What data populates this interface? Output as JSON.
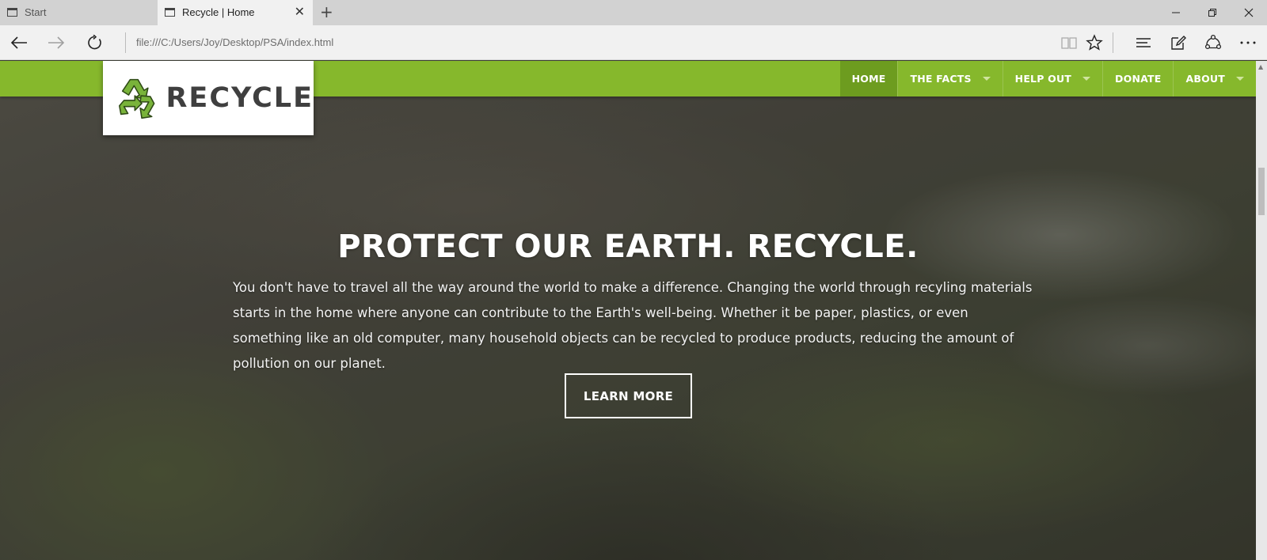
{
  "browser": {
    "tabs": [
      {
        "label": "Start",
        "active": false
      },
      {
        "label": "Recycle | Home",
        "active": true
      }
    ],
    "url": "file:///C:/Users/Joy/Desktop/PSA/index.html"
  },
  "site": {
    "logo_text": "RECYCLE",
    "brand_color": "#86b82c",
    "nav": [
      {
        "label": "HOME",
        "current": true,
        "dropdown": false
      },
      {
        "label": "THE FACTS",
        "current": false,
        "dropdown": true
      },
      {
        "label": "HELP OUT",
        "current": false,
        "dropdown": true
      },
      {
        "label": "DONATE",
        "current": false,
        "dropdown": false
      },
      {
        "label": "ABOUT",
        "current": false,
        "dropdown": true
      }
    ]
  },
  "hero": {
    "title": "PROTECT OUR EARTH. RECYCLE.",
    "body": "You don't have to travel all the way around the world to make a difference. Changing the world through recyling materials starts in the home where anyone can contribute to the Earth's well-being. Whether it be paper, plastics, or even something like an old computer, many household objects can be recycled to produce products, reducing the amount of pollution on our planet.",
    "button_label": "LEARN MORE"
  }
}
